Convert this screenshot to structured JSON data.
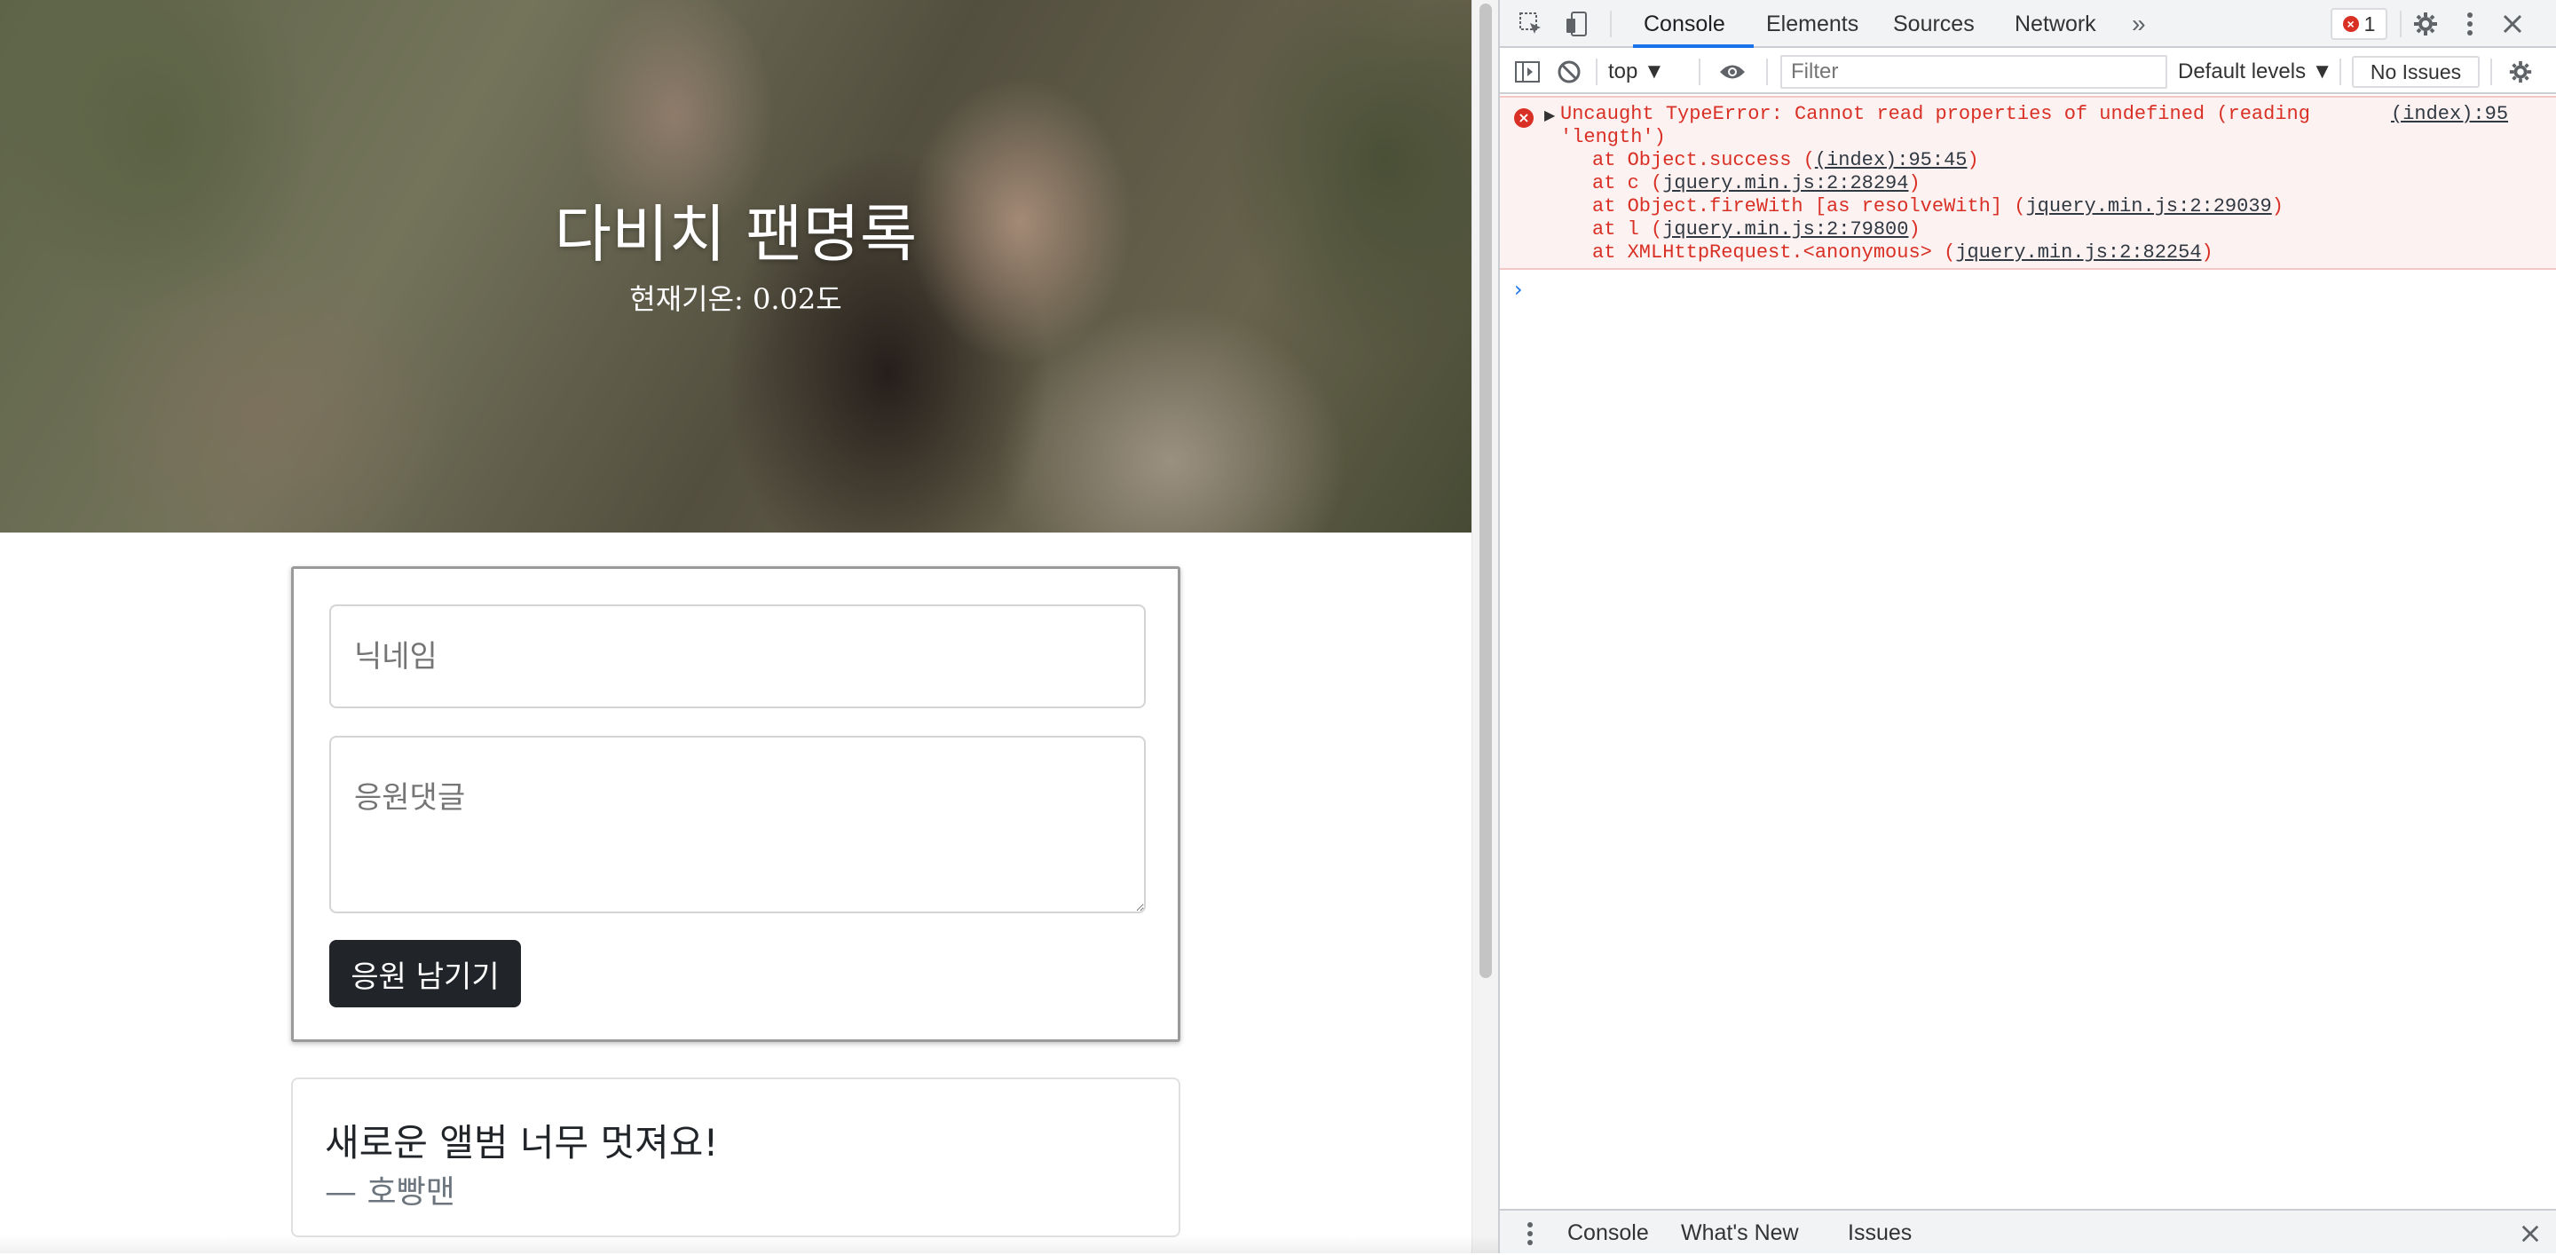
{
  "hero": {
    "title": "다비치 팬명록",
    "temperature_text": "현재기온: 0.02도"
  },
  "form": {
    "nickname_placeholder": "닉네임",
    "comment_placeholder": "응원댓글",
    "submit_label": "응원 남기기"
  },
  "posts": [
    {
      "comment": "새로운 앨범 너무 멋져요!",
      "author": "— 호빵맨"
    }
  ],
  "devtools": {
    "tabs": [
      "Console",
      "Elements",
      "Sources",
      "Network"
    ],
    "more_tabs": "»",
    "error_count": "1",
    "context": "top ▼",
    "filter_placeholder": "Filter",
    "levels": "Default levels ▼",
    "issues": "No Issues",
    "error": {
      "message": "Uncaught TypeError: Cannot read properties of undefined (reading\n'length')",
      "location": "(index):95",
      "stack": [
        {
          "prefix": "at Object.success (",
          "link": "(index):95:45",
          "suffix": ")"
        },
        {
          "prefix": "at c (",
          "link": "jquery.min.js:2:28294",
          "suffix": ")"
        },
        {
          "prefix": "at Object.fireWith [as resolveWith] (",
          "link": "jquery.min.js:2:29039",
          "suffix": ")"
        },
        {
          "prefix": "at l (",
          "link": "jquery.min.js:2:79800",
          "suffix": ")"
        },
        {
          "prefix": "at XMLHttpRequest.<anonymous> (",
          "link": "jquery.min.js:2:82254",
          "suffix": ")"
        }
      ]
    },
    "prompt": "›",
    "drawer_tabs": [
      "Console",
      "What's New",
      "Issues"
    ],
    "colors": {
      "error_red": "#d93025",
      "accent_blue": "#1a73e8"
    }
  }
}
